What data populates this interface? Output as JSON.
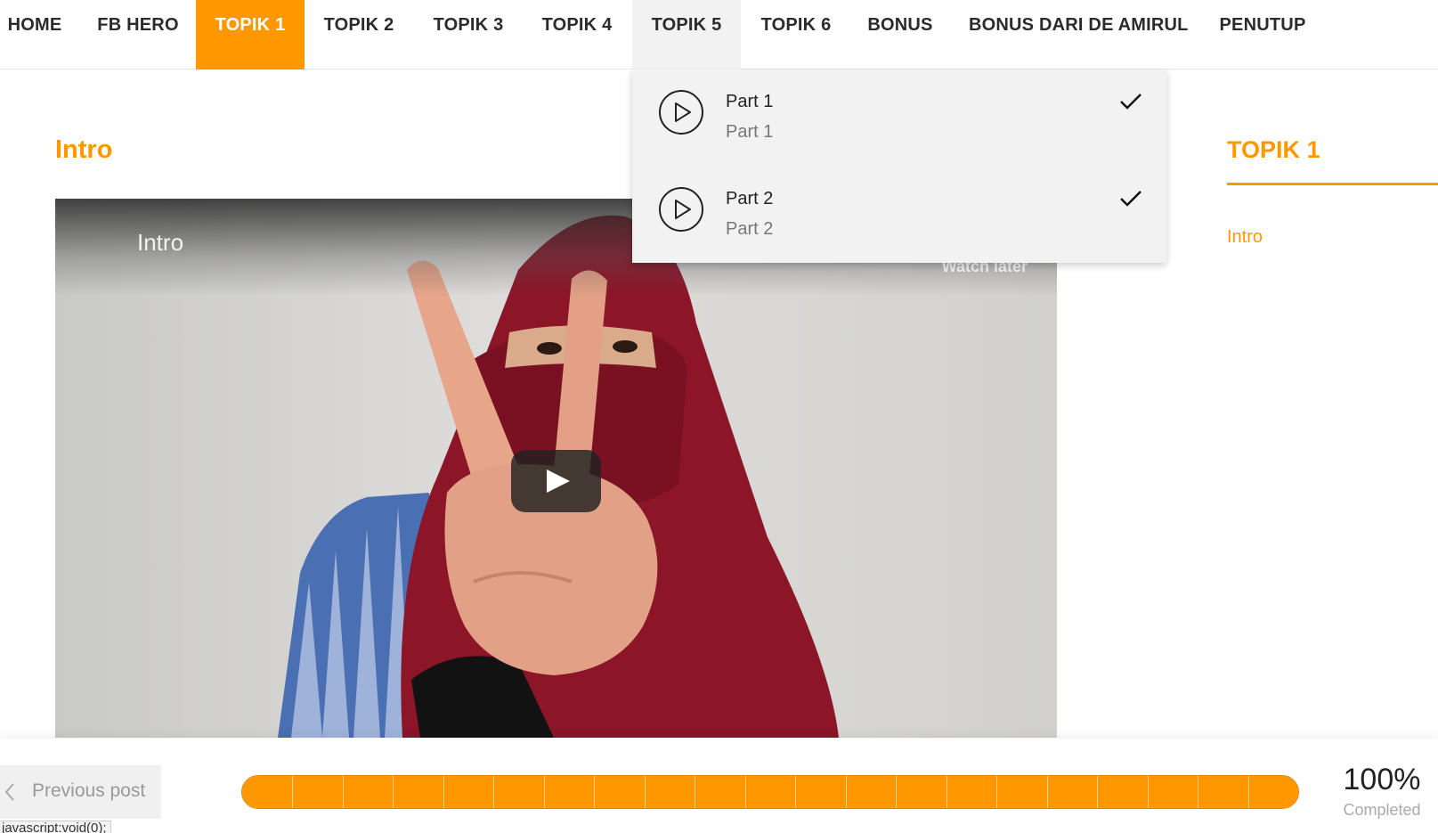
{
  "nav": {
    "items": [
      {
        "label": "HOME"
      },
      {
        "label": "FB HERO"
      },
      {
        "label": "TOPIK 1"
      },
      {
        "label": "TOPIK 2"
      },
      {
        "label": "TOPIK 3"
      },
      {
        "label": "TOPIK 4"
      },
      {
        "label": "TOPIK 5"
      },
      {
        "label": "TOPIK 6"
      },
      {
        "label": "BONUS"
      },
      {
        "label": "BONUS DARI DE AMIRUL"
      },
      {
        "label": "PENUTUP"
      }
    ],
    "active": "TOPIK 1",
    "hovered": "TOPIK 5"
  },
  "dropdown": {
    "items": [
      {
        "title": "Part 1",
        "subtitle": "Part 1",
        "completed": true
      },
      {
        "title": "Part 2",
        "subtitle": "Part 2",
        "completed": true
      }
    ]
  },
  "main": {
    "section_title": "Intro",
    "video": {
      "title": "Intro",
      "watch_later": "Watch later"
    }
  },
  "sidebar": {
    "title": "TOPIK 1",
    "links": [
      {
        "label": "Intro"
      }
    ]
  },
  "footer": {
    "prev_label": "Previous post",
    "progress_percent": 100,
    "progress_segments": 21,
    "percent_text": "100%",
    "completed_label": "Completed",
    "status_url": "javascript:void(0);"
  },
  "colors": {
    "accent": "#ff9800",
    "hover_bg": "#f2f2f2"
  }
}
